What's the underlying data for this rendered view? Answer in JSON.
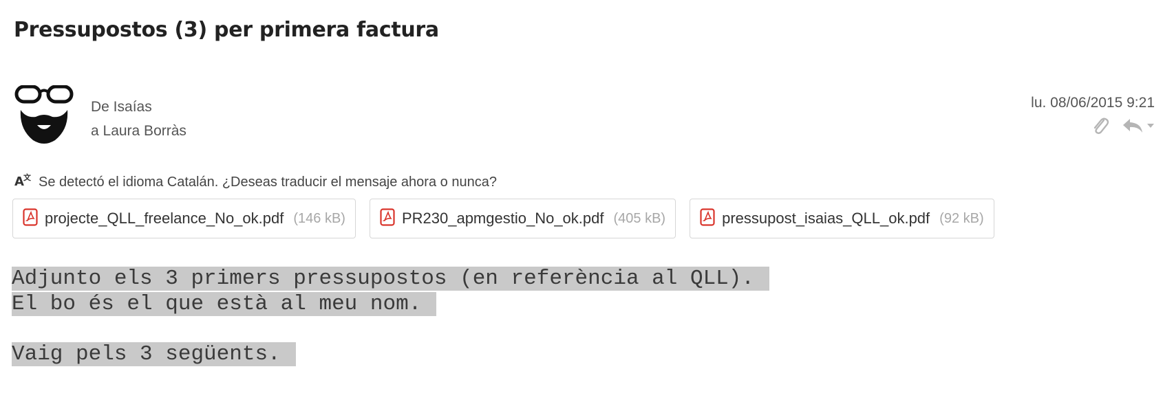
{
  "subject": "Pressupostos (3) per primera factura",
  "sender": {
    "from_line": "De Isaías",
    "to_line": "a Laura Borràs",
    "date": "lu. 08/06/2015 9:21"
  },
  "translation_bar": {
    "message": "Se detectó el idioma Catalán. ¿Deseas traducir el mensaje ahora o nunca?"
  },
  "attachments": [
    {
      "name": "projecte_QLL_freelance_No_ok.pdf",
      "size": "(146 kB)"
    },
    {
      "name": "PR230_apmgestio_No_ok.pdf",
      "size": "(405 kB)"
    },
    {
      "name": "pressupost_isaias_QLL_ok.pdf",
      "size": "(92 kB)"
    }
  ],
  "body": {
    "line1": "Adjunto els 3 primers pressupostos (en referència al QLL).",
    "line2": "El bo és el que està al meu nom.",
    "line3": "Vaig pels 3 següents."
  },
  "icons": {
    "avatar": "hipster-avatar-icon",
    "attachment": "paperclip-icon",
    "reply": "reply-icon",
    "dropdown": "chevron-down-icon",
    "translate": "translate-icon",
    "pdf": "pdf-icon"
  },
  "colors": {
    "pdf_red": "#d9342b",
    "highlight": "#c9c9c9",
    "muted_icon": "#b5b5b5"
  }
}
